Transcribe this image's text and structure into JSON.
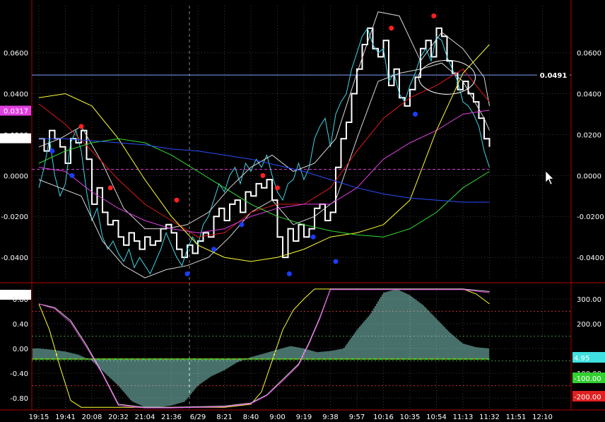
{
  "colors": {
    "background": "#000000",
    "frame": "#b00000",
    "grid": "#3a3a3a",
    "price": "#ffffff",
    "cyan": "#3fd6e6",
    "red_ma": "#e01818",
    "magenta_ma": "#e040e0",
    "yellow_wave": "#ffff33",
    "green_wave": "#33dd33",
    "blue_wave": "#2a4dff",
    "envelope": "#d8d8d8",
    "hist": "#8fe0d6",
    "marker_red": "#ff2020",
    "marker_blue": "#1a3dff"
  },
  "chart_data": [
    {
      "type": "line",
      "panel": "price",
      "x_ticks": [
        "19:15",
        "19:41",
        "20:08",
        "20:32",
        "21:04",
        "21:36",
        "6/29",
        "8:21",
        "8:40",
        "9:00",
        "9:19",
        "9:38",
        "9:57",
        "10:16",
        "10:35",
        "10:54",
        "11:13",
        "11:32",
        "11:51",
        "12:10"
      ],
      "y_ticks": [
        "0.0600",
        "0.0400",
        "0.0200",
        "0.0000",
        "-0.0200",
        "-0.0400"
      ],
      "ylim": [
        -0.051,
        0.083
      ],
      "xlim": [
        0,
        19.3
      ],
      "grid": true,
      "tags": {
        "current_level": "0.0491",
        "magenta_tag": "0.0317",
        "price_tag": "0.0182"
      },
      "horizontal_line": 0.0491,
      "dashed_level": 0.003,
      "series": [
        {
          "color_key": "price",
          "x": [
            0,
            0.2,
            0.4,
            0.6,
            0.8,
            1,
            1.2,
            1.4,
            1.6,
            1.8,
            2,
            2.2,
            2.4,
            2.6,
            2.8,
            3,
            3.2,
            3.4,
            3.6,
            3.8,
            4,
            4.2,
            4.4,
            4.6,
            4.8,
            5,
            5.2,
            5.4,
            5.6,
            5.8,
            6,
            6.2,
            6.4,
            6.6,
            6.8,
            7,
            7.2,
            7.4,
            7.6,
            7.8,
            8,
            8.2,
            8.4,
            8.6,
            8.8,
            9,
            9.2,
            9.4,
            9.6,
            9.8,
            10,
            10.2,
            10.4,
            10.6,
            10.8,
            11,
            11.2,
            11.4,
            11.6,
            11.8,
            12,
            12.2,
            12.4,
            12.6,
            12.8,
            13,
            13.2,
            13.4,
            13.6,
            13.8,
            14,
            14.2,
            14.4,
            14.6,
            14.8,
            15,
            15.2,
            15.4,
            15.6,
            15.8,
            16,
            16.2,
            16.4,
            16.6,
            16.8,
            17
          ],
          "values": [
            0.018,
            0.012,
            0.022,
            0.018,
            0.014,
            0.006,
            0.018,
            0.016,
            0.022,
            0.008,
            -0.014,
            -0.006,
            -0.018,
            -0.024,
            -0.022,
            -0.03,
            -0.034,
            -0.028,
            -0.032,
            -0.036,
            -0.03,
            -0.034,
            -0.032,
            -0.026,
            -0.024,
            -0.028,
            -0.036,
            -0.04,
            -0.034,
            -0.038,
            -0.032,
            -0.028,
            -0.03,
            -0.02,
            -0.016,
            -0.022,
            -0.014,
            -0.012,
            -0.018,
            -0.008,
            -0.01,
            -0.004,
            -0.006,
            -0.002,
            -0.012,
            -0.03,
            -0.04,
            -0.026,
            -0.032,
            -0.024,
            -0.03,
            -0.026,
            -0.016,
            -0.014,
            -0.022,
            -0.018,
            0.004,
            0.018,
            0.026,
            0.04,
            0.052,
            0.064,
            0.072,
            0.062,
            0.058,
            0.066,
            0.044,
            0.052,
            0.038,
            0.034,
            0.042,
            0.048,
            0.062,
            0.066,
            0.058,
            0.072,
            0.068,
            0.056,
            0.05,
            0.042,
            0.046,
            0.04,
            0.036,
            0.028,
            0.018,
            0.014
          ],
          "width": 2
        },
        {
          "color_key": "cyan",
          "x": [
            0,
            0.2,
            0.4,
            0.6,
            0.8,
            1,
            1.2,
            1.4,
            1.6,
            1.8,
            2,
            2.2,
            2.4,
            2.6,
            2.8,
            3,
            3.2,
            3.4,
            3.6,
            3.8,
            4,
            4.2,
            4.4,
            4.6,
            4.8,
            5,
            5.2,
            5.4,
            5.6,
            5.8,
            6,
            6.2,
            6.4,
            6.6,
            6.8,
            7,
            7.2,
            7.4,
            7.6,
            7.8,
            8,
            8.2,
            8.4,
            8.6,
            8.8,
            9,
            9.2,
            9.4,
            9.6,
            9.8,
            10,
            10.2,
            10.4,
            10.6,
            10.8,
            11,
            11.2,
            11.4,
            11.6,
            11.8,
            12,
            12.2,
            12.4,
            12.6,
            12.8,
            13,
            13.2,
            13.4,
            13.6,
            13.8,
            14,
            14.2,
            14.4,
            14.6,
            14.8,
            15,
            15.2,
            15.4,
            15.6,
            15.8,
            16,
            16.2,
            16.4,
            16.6,
            16.8,
            17
          ],
          "values": [
            -0.006,
            0.004,
            0.018,
            0.0,
            -0.01,
            -0.004,
            0.016,
            0.022,
            0.012,
            -0.008,
            -0.022,
            -0.016,
            -0.03,
            -0.036,
            -0.032,
            -0.038,
            -0.042,
            -0.036,
            -0.045,
            -0.04,
            -0.044,
            -0.048,
            -0.042,
            -0.036,
            -0.028,
            -0.034,
            -0.04,
            -0.044,
            -0.036,
            -0.03,
            -0.034,
            -0.024,
            -0.02,
            -0.012,
            -0.004,
            -0.008,
            0.0,
            0.004,
            -0.004,
            0.006,
            0.002,
            0.008,
            0.004,
            0.01,
            0.0,
            -0.008,
            -0.012,
            -0.004,
            -0.002,
            0.006,
            -0.002,
            0.004,
            0.018,
            0.024,
            0.028,
            0.014,
            0.03,
            0.036,
            0.04,
            0.052,
            0.06,
            0.068,
            0.072,
            0.064,
            0.06,
            0.062,
            0.046,
            0.05,
            0.04,
            0.036,
            0.044,
            0.05,
            0.058,
            0.062,
            0.056,
            0.068,
            0.066,
            0.058,
            0.052,
            0.046,
            0.036,
            0.034,
            0.03,
            0.024,
            0.012,
            0.004
          ],
          "width": 1
        },
        {
          "color_key": "envelope",
          "x": [
            0,
            0.8,
            1.6,
            2.4,
            3.2,
            4,
            4.8,
            5.6,
            6.4,
            7.2,
            8,
            8.8,
            9.6,
            10.4,
            11.2,
            12,
            12.8,
            13.6,
            14.4,
            15.2,
            16,
            16.8,
            17
          ],
          "values": [
            -0.002,
            -0.006,
            -0.01,
            -0.032,
            -0.044,
            -0.05,
            -0.046,
            -0.044,
            -0.04,
            -0.03,
            -0.018,
            -0.012,
            -0.024,
            -0.02,
            -0.012,
            0.018,
            0.046,
            0.05,
            0.052,
            0.055,
            0.046,
            0.028,
            0.022
          ],
          "width": 1
        },
        {
          "color_key": "envelope",
          "x": [
            0,
            0.8,
            1.6,
            2.4,
            3.2,
            4,
            4.8,
            5.6,
            6.4,
            7.2,
            8,
            8.8,
            9.6,
            10.4,
            11.2,
            12,
            12.8,
            13.6,
            14.4,
            15.2,
            16,
            16.8,
            17
          ],
          "values": [
            0.014,
            0.018,
            0.024,
            0.006,
            -0.016,
            -0.026,
            -0.026,
            -0.024,
            -0.018,
            -0.006,
            0.004,
            0.01,
            0.002,
            0.006,
            0.018,
            0.05,
            0.08,
            0.078,
            0.056,
            0.07,
            0.062,
            0.048,
            0.034
          ],
          "width": 1
        },
        {
          "color_key": "red_ma",
          "x": [
            0,
            1,
            2,
            3,
            4,
            5,
            6,
            7,
            8,
            9,
            10,
            11,
            12,
            13,
            14,
            15,
            16,
            17
          ],
          "values": [
            0.035,
            0.025,
            0.012,
            -0.002,
            -0.014,
            -0.022,
            -0.03,
            -0.028,
            -0.018,
            -0.014,
            -0.014,
            -0.006,
            0.012,
            0.028,
            0.038,
            0.044,
            0.052,
            0.036
          ],
          "width": 1
        },
        {
          "color_key": "magenta_ma",
          "x": [
            0,
            1,
            2,
            3,
            4,
            5,
            6,
            7,
            8,
            9,
            10,
            11,
            12,
            13,
            14,
            15,
            16,
            17
          ],
          "values": [
            0.004,
            0.002,
            -0.008,
            -0.016,
            -0.022,
            -0.026,
            -0.028,
            -0.026,
            -0.02,
            -0.016,
            -0.014,
            -0.014,
            -0.006,
            0.008,
            0.016,
            0.022,
            0.03,
            0.032
          ],
          "width": 1
        },
        {
          "color_key": "yellow_wave",
          "x": [
            0,
            1,
            2,
            3,
            4,
            5,
            6,
            7,
            8,
            9,
            10,
            11,
            12,
            13,
            14,
            15,
            16,
            17
          ],
          "values": [
            0.038,
            0.04,
            0.034,
            0.018,
            -0.002,
            -0.02,
            -0.034,
            -0.04,
            -0.042,
            -0.04,
            -0.036,
            -0.03,
            -0.028,
            -0.024,
            -0.012,
            0.022,
            0.05,
            0.064
          ],
          "width": 1
        },
        {
          "color_key": "green_wave",
          "x": [
            0,
            1,
            2,
            3,
            4,
            5,
            6,
            7,
            8,
            9,
            10,
            11,
            12,
            13,
            14,
            15,
            16,
            17
          ],
          "values": [
            0.006,
            0.012,
            0.016,
            0.018,
            0.016,
            0.01,
            0.002,
            -0.006,
            -0.014,
            -0.02,
            -0.024,
            -0.027,
            -0.029,
            -0.03,
            -0.026,
            -0.018,
            -0.006,
            0.002
          ],
          "width": 1
        },
        {
          "color_key": "blue_wave",
          "x": [
            0,
            1,
            2,
            3,
            4,
            5,
            6,
            7,
            8,
            9,
            10,
            11,
            12,
            13,
            14,
            15,
            16,
            17
          ],
          "values": [
            0.018,
            0.018,
            0.017,
            0.016,
            0.015,
            0.013,
            0.012,
            0.01,
            0.008,
            0.005,
            0.002,
            -0.002,
            -0.006,
            -0.009,
            -0.011,
            -0.012,
            -0.013,
            -0.013
          ],
          "width": 1
        }
      ],
      "markers": {
        "red": [
          {
            "x": 1.6,
            "y": 0.024
          },
          {
            "x": 2.7,
            "y": -0.006
          },
          {
            "x": 5.2,
            "y": -0.012
          },
          {
            "x": 8.45,
            "y": 0.0
          },
          {
            "x": 9.0,
            "y": -0.006
          },
          {
            "x": 13.3,
            "y": 0.072
          },
          {
            "x": 14.9,
            "y": 0.078
          }
        ],
        "blue": [
          {
            "x": 0.5,
            "y": 0.012
          },
          {
            "x": 1.25,
            "y": 0.0
          },
          {
            "x": 5.6,
            "y": -0.048
          },
          {
            "x": 6.6,
            "y": -0.036
          },
          {
            "x": 7.65,
            "y": -0.024
          },
          {
            "x": 9.45,
            "y": -0.048
          },
          {
            "x": 10.35,
            "y": -0.03
          },
          {
            "x": 11.2,
            "y": -0.042
          },
          {
            "x": 14.2,
            "y": 0.03
          }
        ]
      },
      "annotation_ellipse": {
        "x": 15.4,
        "y": 0.048
      }
    },
    {
      "type": "line",
      "panel": "oscillator",
      "y_ticks_left": [
        "0.80",
        "0.40",
        "0.00",
        "-0.40",
        "-0.80"
      ],
      "y_ticks_right": [
        "300.00",
        "200.00",
        "100.00"
      ],
      "ylim": [
        -0.97,
        0.97
      ],
      "tags": {
        "top_left": "0.92",
        "hist_value": "4.95",
        "minus_100": "-100.00",
        "minus_200": "-200.00"
      },
      "series": [
        {
          "color_key": "yellow_wave",
          "x": [
            0,
            0.4,
            0.8,
            1.2,
            1.6,
            2,
            2.4,
            3,
            4,
            5,
            6,
            7,
            8,
            8.4,
            8.8,
            9.2,
            9.6,
            10,
            10.4,
            10.8,
            12,
            13,
            14,
            15,
            16,
            16.5,
            17
          ],
          "values": [
            0.72,
            0.3,
            -0.3,
            -0.84,
            -0.95,
            -0.95,
            -0.95,
            -0.95,
            -0.95,
            -0.95,
            -0.95,
            -0.95,
            -0.9,
            -0.7,
            -0.2,
            0.3,
            0.62,
            0.8,
            0.96,
            0.96,
            0.96,
            0.96,
            0.96,
            0.96,
            0.96,
            0.88,
            0.72
          ],
          "width": 1
        },
        {
          "color_key": "envelope",
          "x": [
            0,
            0.6,
            1.2,
            1.8,
            2.4,
            3,
            4,
            5,
            6,
            7,
            8,
            8.6,
            9.2,
            9.8,
            10.2,
            10.6,
            11,
            12,
            13,
            14,
            15,
            16,
            17
          ],
          "values": [
            0.72,
            0.66,
            0.45,
            0.05,
            -0.4,
            -0.9,
            -0.95,
            -0.95,
            -0.94,
            -0.93,
            -0.88,
            -0.75,
            -0.5,
            -0.25,
            0.1,
            0.5,
            0.96,
            0.96,
            0.96,
            0.96,
            0.96,
            0.96,
            0.92
          ],
          "width": 1
        },
        {
          "color_key": "magenta_ma",
          "x": [
            0,
            0.6,
            1.2,
            1.8,
            2.4,
            3,
            4,
            5,
            6,
            7,
            8,
            8.6,
            9.2,
            9.8,
            10.2,
            10.6,
            11,
            12,
            13,
            14,
            15,
            16,
            17
          ],
          "values": [
            0.72,
            0.64,
            0.42,
            0.02,
            -0.42,
            -0.92,
            -0.96,
            -0.96,
            -0.95,
            -0.94,
            -0.89,
            -0.76,
            -0.52,
            -0.27,
            0.08,
            0.48,
            0.95,
            0.95,
            0.95,
            0.95,
            0.95,
            0.95,
            0.9
          ],
          "width": 1
        }
      ],
      "histogram": {
        "x": [
          0,
          0.5,
          1,
          1.5,
          2,
          2.5,
          3,
          3.5,
          4,
          4.5,
          5,
          5.5,
          6,
          6.5,
          7,
          7.5,
          8,
          8.5,
          9,
          9.5,
          10,
          10.5,
          11,
          11.5,
          12,
          12.5,
          13,
          13.5,
          14,
          14.5,
          15,
          15.5,
          16,
          16.5,
          17
        ],
        "values": [
          0.0,
          -0.02,
          -0.05,
          -0.1,
          -0.2,
          -0.4,
          -0.6,
          -0.85,
          -0.95,
          -0.95,
          -0.92,
          -0.86,
          -0.6,
          -0.45,
          -0.35,
          -0.22,
          -0.14,
          -0.08,
          -0.02,
          0.04,
          0.0,
          -0.06,
          -0.04,
          0.0,
          0.3,
          0.55,
          0.9,
          0.96,
          0.86,
          0.7,
          0.48,
          0.26,
          0.08,
          0.02,
          0.0
        ]
      },
      "dotted_levels": [
        0.6,
        -0.6,
        0.2,
        -0.2
      ],
      "dashed_level": -0.17
    }
  ]
}
